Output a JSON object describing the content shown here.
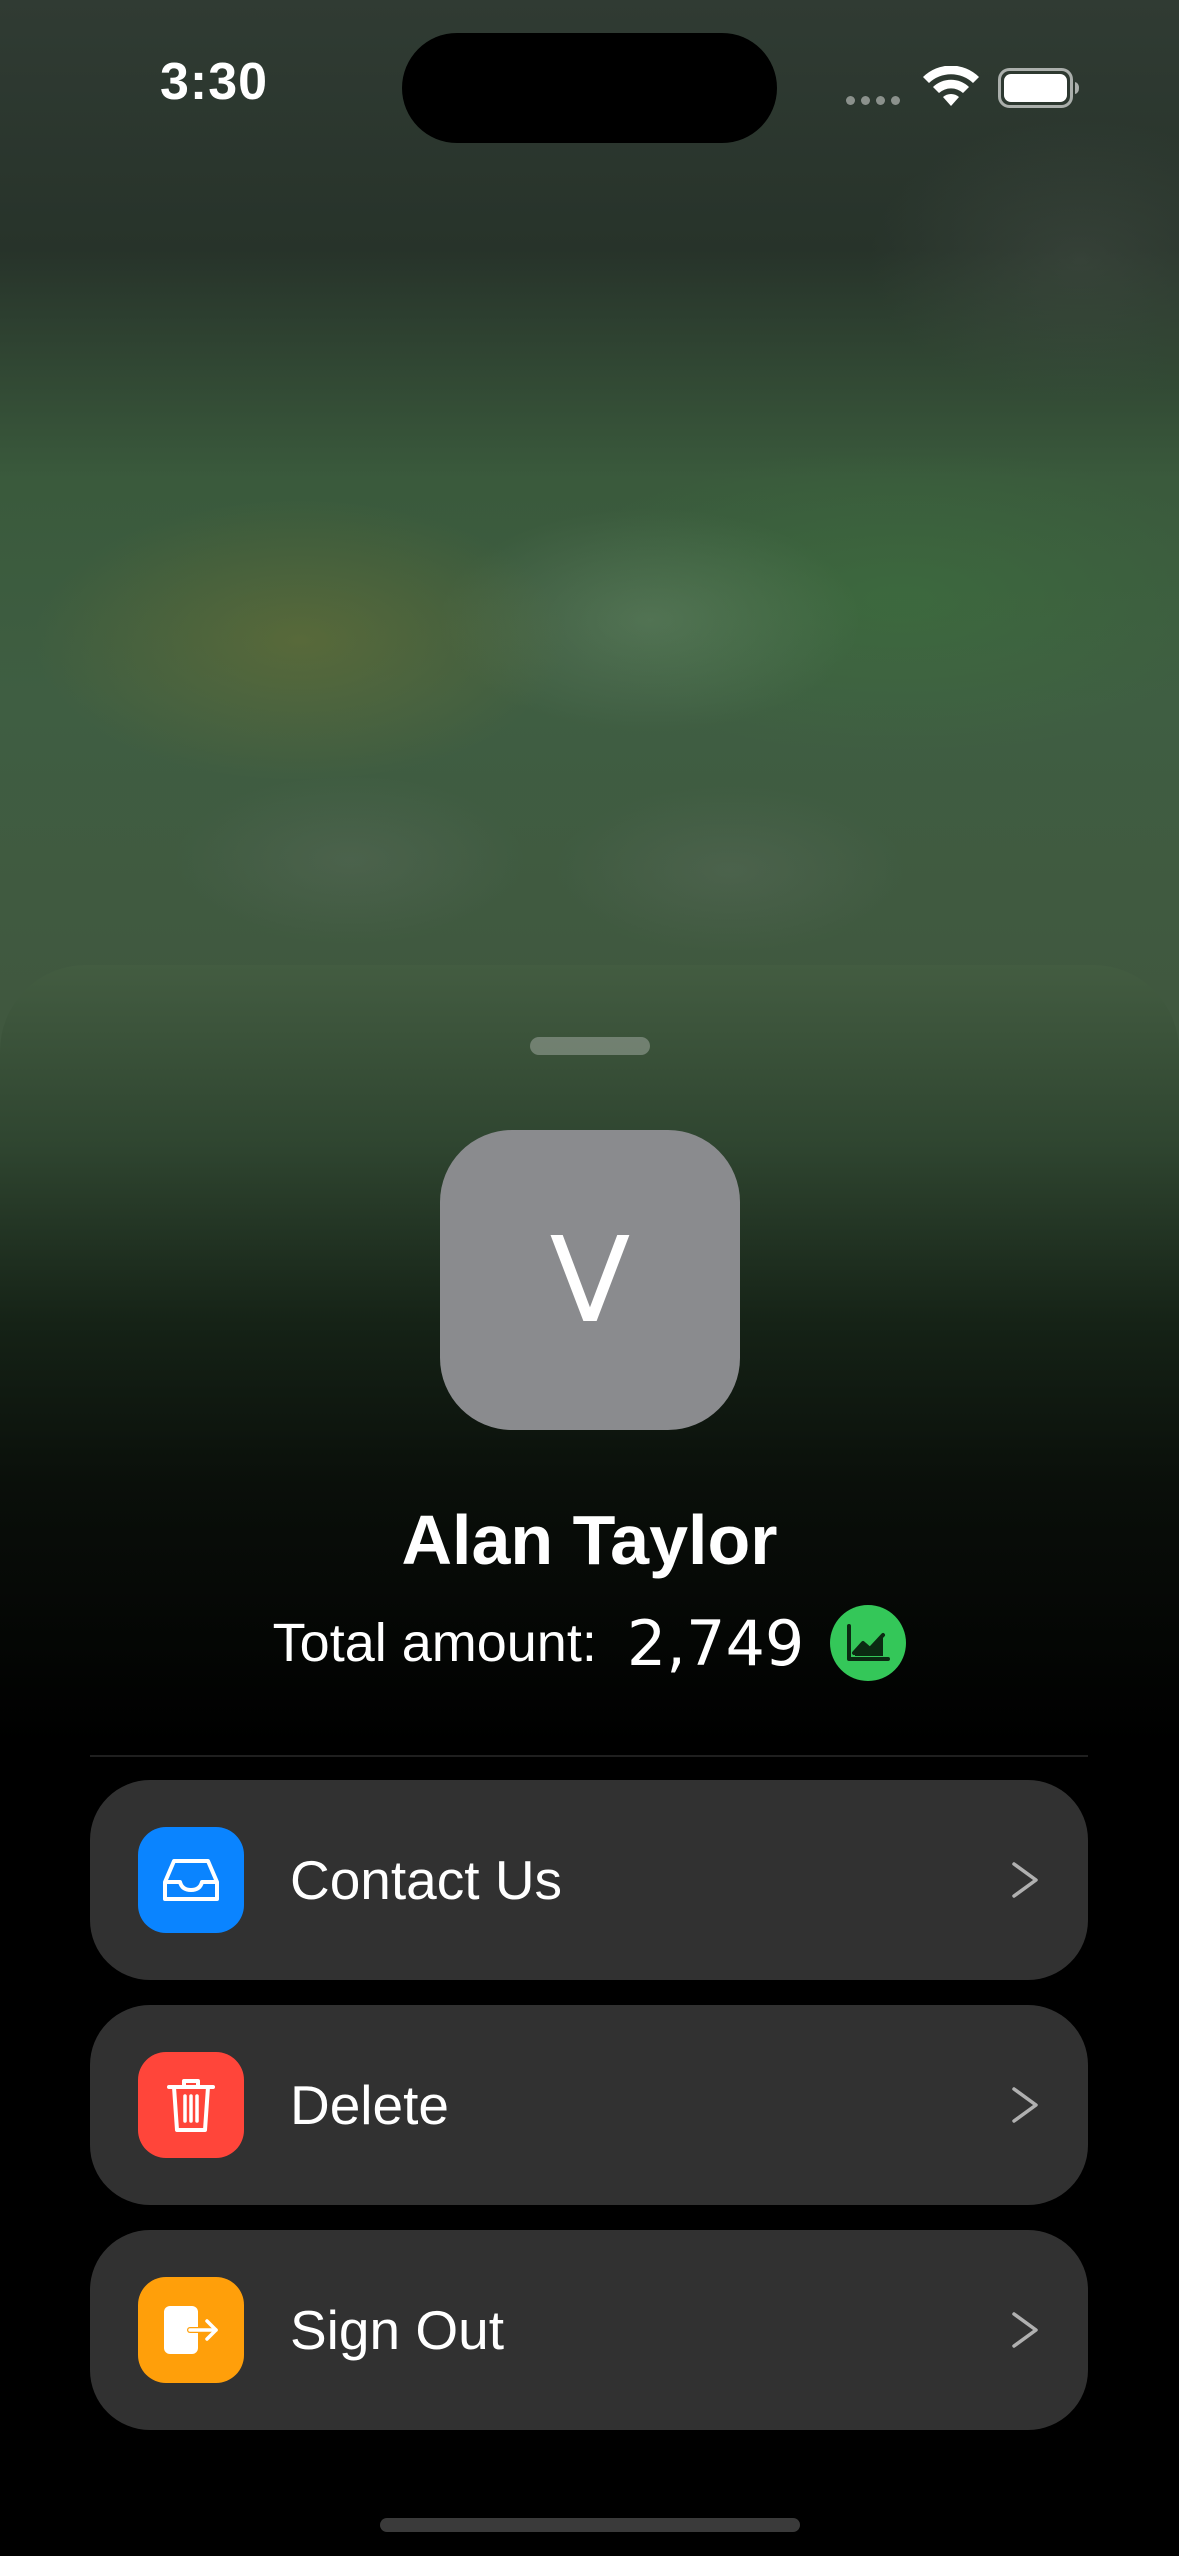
{
  "status_bar": {
    "time": "3:30",
    "icons": [
      "signal-dots-icon",
      "wifi-icon",
      "battery-icon"
    ]
  },
  "profile": {
    "avatar_letter": "V",
    "name": "Alan Taylor",
    "total_label": "Total amount:",
    "total_value": "2,749",
    "badge_icon": "chart-line-icon"
  },
  "menu": {
    "items": [
      {
        "label": "Contact Us",
        "icon": "inbox-tray-icon",
        "color": "#0a84ff"
      },
      {
        "label": "Delete",
        "icon": "trash-icon",
        "color": "#ff453a"
      },
      {
        "label": "Sign Out",
        "icon": "sign-out-icon",
        "color": "#ff9f0a"
      }
    ],
    "chevron": ">"
  },
  "colors": {
    "avatar_bg": "#8a8b8e",
    "badge_green": "#34c759",
    "row_bg": "#313131"
  }
}
